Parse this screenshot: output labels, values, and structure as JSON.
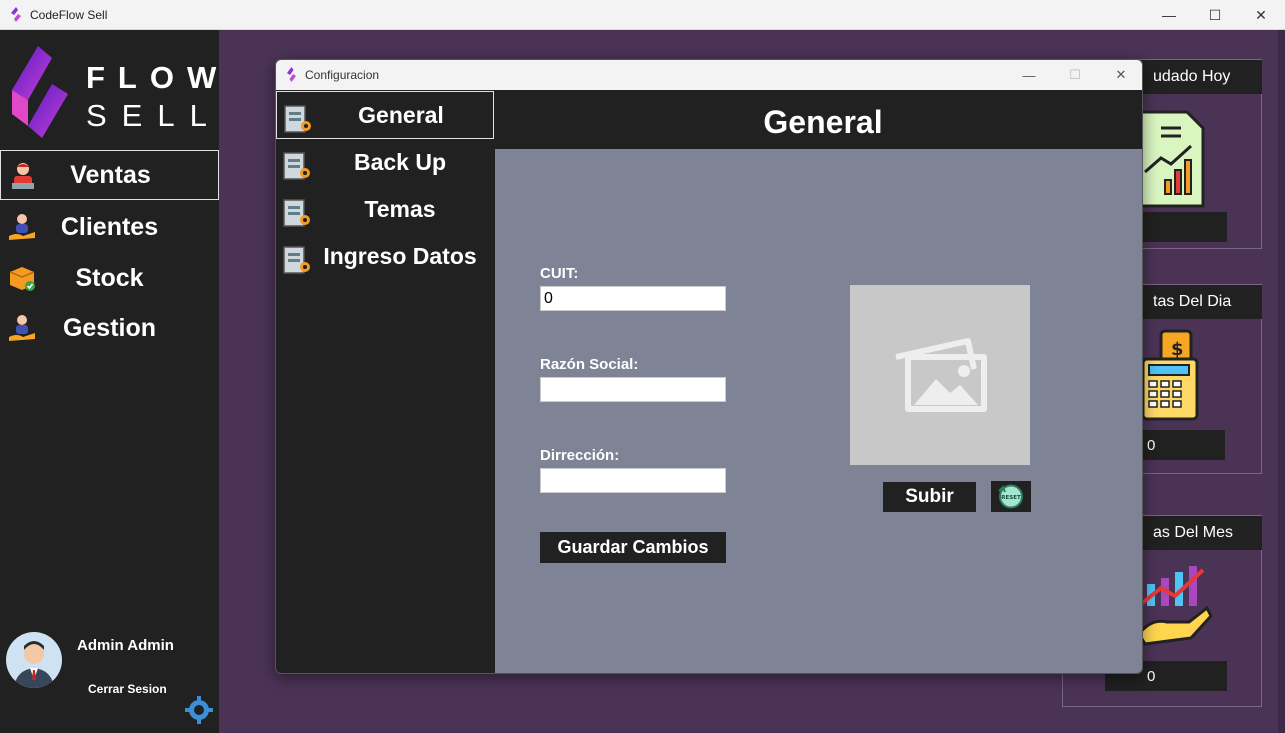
{
  "window": {
    "title": "CodeFlow Sell",
    "minimize": "—",
    "maximize": "☐",
    "close": "✕"
  },
  "logo": {
    "line1": "FLOW",
    "line2": "SELL"
  },
  "sidebar": {
    "items": [
      {
        "label": "Ventas",
        "icon": "sales-person-icon",
        "active": true
      },
      {
        "label": "Clientes",
        "icon": "clients-icon"
      },
      {
        "label": "Stock",
        "icon": "stock-box-icon"
      },
      {
        "label": "Gestion",
        "icon": "management-icon"
      }
    ],
    "user": {
      "name": "Admin Admin",
      "logout": "Cerrar Sesion"
    }
  },
  "cards": [
    {
      "title": "udado Hoy",
      "value": ""
    },
    {
      "title": "tas Del Dia",
      "value": "0"
    },
    {
      "title": "as Del Mes",
      "value": "0"
    }
  ],
  "dialog": {
    "title": "Configuracion",
    "menu": [
      {
        "label": "General",
        "active": true
      },
      {
        "label": "Back Up"
      },
      {
        "label": "Temas"
      },
      {
        "label": "Ingreso Datos"
      }
    ],
    "header": "General",
    "form": {
      "cuit_label": "CUIT:",
      "cuit_value": "0",
      "razon_label": "Razón Social:",
      "razon_value": "",
      "direccion_label": "Dirrección:",
      "direccion_value": "",
      "save_button": "Guardar Cambios",
      "upload_button": "Subir",
      "reset_label": "RESET"
    }
  },
  "colors": {
    "background": "#4b3356",
    "panel": "#212121",
    "content": "#7e8495",
    "accent": "#8e2de2"
  }
}
